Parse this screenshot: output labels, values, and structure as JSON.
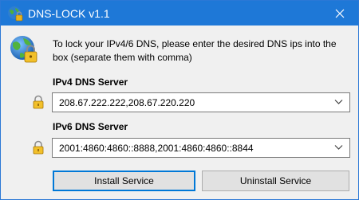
{
  "window": {
    "title": "DNS-LOCK v1.1",
    "title_icon": "globe-lock-icon",
    "close_icon": "close-icon",
    "titlebar_color": "#1e78d7"
  },
  "intro": {
    "icon": "globe-lock-icon",
    "text": "To lock your IPv4/6 DNS, please enter the desired DNS ips into the box (separate them with comma)"
  },
  "ipv4": {
    "label": "IPv4 DNS Server",
    "value": "208.67.222.222,208.67.220.220",
    "icon": "lock-icon"
  },
  "ipv6": {
    "label": "IPv6 DNS Server",
    "value": "2001:4860:4860::8888,2001:4860:4860::8844",
    "icon": "lock-icon"
  },
  "buttons": {
    "install": "Install Service",
    "uninstall": "Uninstall Service"
  }
}
